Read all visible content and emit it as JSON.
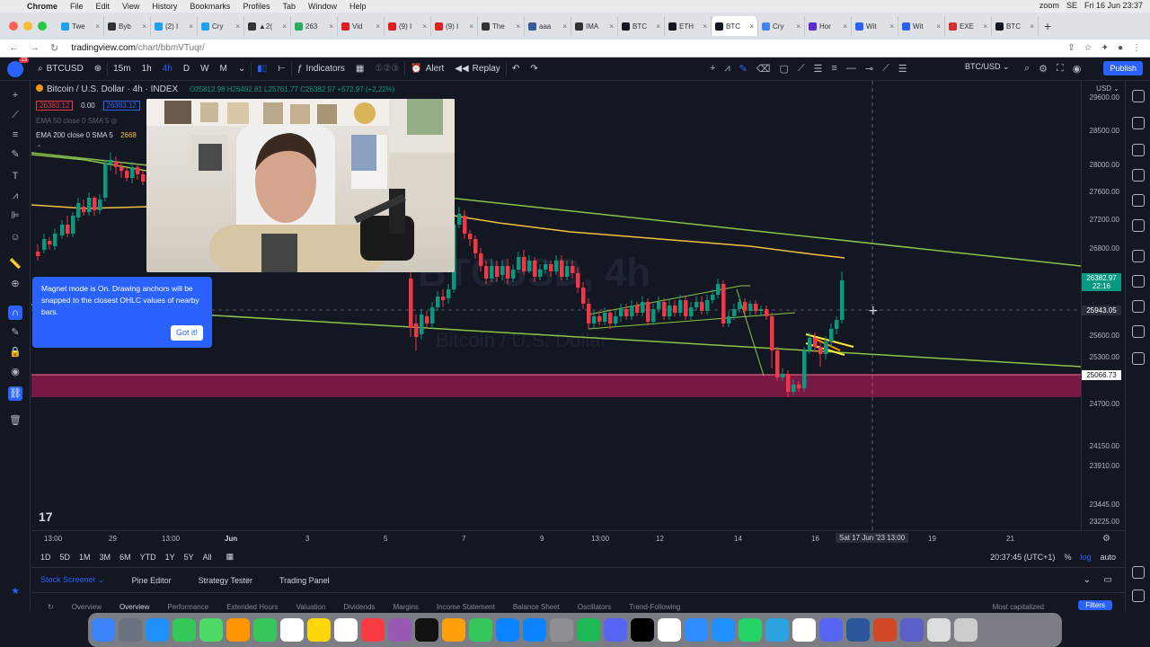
{
  "menubar": {
    "app": "Chrome",
    "items": [
      "File",
      "Edit",
      "View",
      "History",
      "Bookmarks",
      "Profiles",
      "Tab",
      "Window",
      "Help"
    ],
    "right": {
      "zoom": "zoom",
      "region": "SE",
      "datetime": "Fri 16 Jun 23:37"
    }
  },
  "tabs": [
    {
      "label": "Twe",
      "color": "#1da1f2"
    },
    {
      "label": "Byb",
      "color": "#333333"
    },
    {
      "label": "(2) I",
      "color": "#1da1f2"
    },
    {
      "label": "Cry",
      "color": "#1da1f2"
    },
    {
      "label": "▲2(",
      "color": "#333333"
    },
    {
      "label": "263",
      "color": "#27ae60"
    },
    {
      "label": "Vid",
      "color": "#e02020"
    },
    {
      "label": "(9) I",
      "color": "#e02020"
    },
    {
      "label": "(9) I",
      "color": "#e02020"
    },
    {
      "label": "The",
      "color": "#333333"
    },
    {
      "label": "aaa",
      "color": "#3b5998"
    },
    {
      "label": "IMA",
      "color": "#333333"
    },
    {
      "label": "BTC",
      "color": "#131722"
    },
    {
      "label": "ETH",
      "color": "#131722"
    },
    {
      "label": "BTC",
      "color": "#131722"
    },
    {
      "label": "Cry",
      "color": "#4285f4"
    },
    {
      "label": "Hor",
      "color": "#5b2bd6"
    },
    {
      "label": "Wit",
      "color": "#2962ff"
    },
    {
      "label": "Wit",
      "color": "#2962ff"
    },
    {
      "label": "EXE",
      "color": "#d32f2f"
    },
    {
      "label": "BTC",
      "color": "#131722"
    }
  ],
  "address": {
    "domain": "tradingview.com",
    "path": "/chart/bbmVTuqr/"
  },
  "toolbar": {
    "symbol": "BTCUSD",
    "notifications": "13",
    "intervals": [
      "15m",
      "1h",
      "4h",
      "D",
      "W",
      "M"
    ],
    "indicators": "Indicators",
    "alert": "Alert",
    "replay": "Replay",
    "symbol_selector": "BTC/USD",
    "publish": "Publish"
  },
  "legend": {
    "title": "Bitcoin / U.S. Dollar · 4h · INDEX",
    "ohlc": "O25812.98 H26492.81 L25761.77 C26382.97 +572.97 (+2.22%)",
    "sell": "26383.12",
    "spread": "0.00",
    "buy": "26383.12",
    "ema50": "EMA 50 close 0 SMA 5",
    "ema200": "EMA 200 close 0 SMA 5",
    "ema200_value": "2668"
  },
  "magnet_tooltip": {
    "text": "Magnet mode is On. Drawing anchors will be snapped to the closest OHLC values of nearby bars.",
    "button": "Got it!"
  },
  "watermark": {
    "symbol": "BTCUSD, 4h",
    "name": "Bitcoin / U.S. Dollar"
  },
  "price_axis": {
    "currency": "USD",
    "ticks": [
      "29600.00",
      "28500.00",
      "28000.00",
      "27600.00",
      "27200.00",
      "26800.00",
      "25600.00",
      "25300.00",
      "24700.00",
      "24150.00",
      "23910.00",
      "23445.00",
      "23225.00"
    ],
    "current_price": "26382.97",
    "countdown": "22:16",
    "crosshair_price": "25943.05",
    "support_price": "25066.73"
  },
  "time_axis": {
    "ticks": [
      "13:00",
      "29",
      "13:00",
      "Jun",
      "3",
      "5",
      "7",
      "9",
      "13:00",
      "12",
      "14",
      "16",
      "19",
      "21"
    ],
    "crosshair_time": "Sat 17 Jun '23  13:00"
  },
  "range_bar": {
    "ranges": [
      "1D",
      "5D",
      "1M",
      "3M",
      "6M",
      "YTD",
      "1Y",
      "5Y",
      "All"
    ],
    "clock": "20:37:45 (UTC+1)",
    "percent": "%",
    "log": "log",
    "auto": "auto"
  },
  "bottom_tabs": [
    "Stock Screener",
    "Pine Editor",
    "Strategy Tester",
    "Trading Panel"
  ],
  "screener": {
    "tabs": [
      "Overview",
      "Overview",
      "Performance",
      "Extended Hours",
      "Valuation",
      "Dividends",
      "Margins",
      "Income Statement",
      "Balance Sheet",
      "Oscillators",
      "Trend-Following"
    ],
    "sort": "Most capitalized",
    "filters": "Filters"
  },
  "colors": {
    "up": "#089981",
    "down": "#f23645",
    "accent": "#2962ff",
    "ema50": "#8bc34a",
    "ema200": "#f0c040",
    "trendline": "#8bc34a",
    "zone": "#8b1a4a"
  },
  "dock": [
    "finder",
    "launchpad",
    "safari",
    "messages",
    "maps",
    "photos",
    "facetime",
    "calendar",
    "notes",
    "reminders",
    "music",
    "podcasts",
    "tv",
    "books",
    "numbers",
    "keynote",
    "appstore",
    "settings",
    "spotify",
    "discord",
    "capcut",
    "chrome",
    "zoom",
    "mail",
    "whatsapp",
    "telegram",
    "chrome-2",
    "discord-2",
    "word",
    "powerpoint",
    "teams",
    "downloads",
    "trash"
  ]
}
